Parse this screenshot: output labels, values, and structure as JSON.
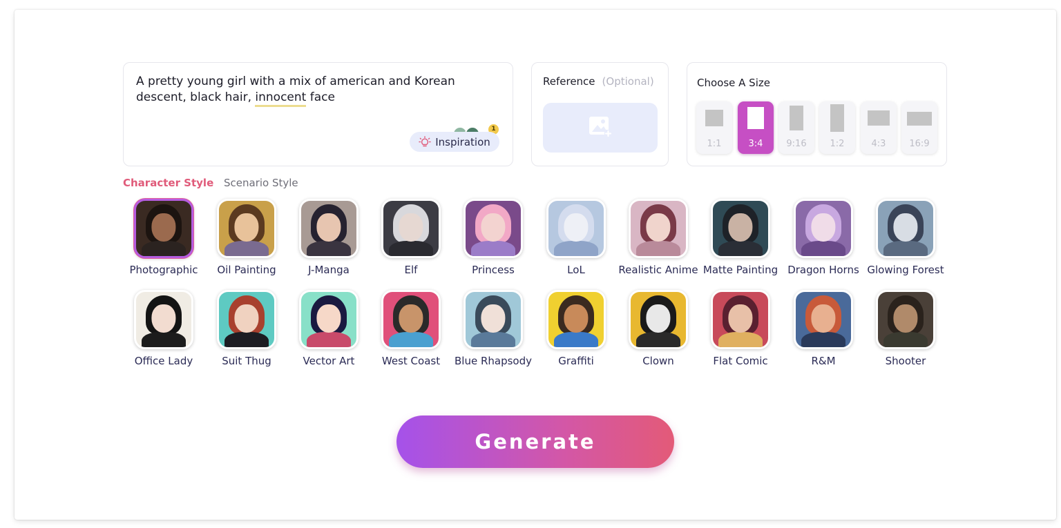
{
  "prompt": {
    "text_before": "A pretty young girl with a mix of american and Korean descent, black hair, ",
    "text_highlight": "innocent",
    "text_after": " face",
    "inspiration_label": "Inspiration",
    "badge_count": "1"
  },
  "reference": {
    "title": "Reference",
    "optional": "(Optional)"
  },
  "size": {
    "title": "Choose A Size",
    "selected": "3:4",
    "options": [
      "1:1",
      "3:4",
      "9:16",
      "1:2",
      "4:3",
      "16:9"
    ]
  },
  "tabs": {
    "character": "Character Style",
    "scenario": "Scenario Style"
  },
  "styles": [
    {
      "label": "Photographic",
      "bg": "#3a2a22",
      "skin": "#9b6a4e",
      "hair": "#1c1410",
      "cloth": "#2b2320"
    },
    {
      "label": "Oil Painting",
      "bg": "#c9a04a",
      "skin": "#e8c29a",
      "hair": "#5b3a20",
      "cloth": "#7a6b90"
    },
    {
      "label": "J-Manga",
      "bg": "#a89a94",
      "skin": "#e7c5b0",
      "hair": "#262230",
      "cloth": "#3a3440"
    },
    {
      "label": "Elf",
      "bg": "#3c3c44",
      "skin": "#e6d8d2",
      "hair": "#d8d8dc",
      "cloth": "#2a2a30"
    },
    {
      "label": "Princess",
      "bg": "#7a4a8a",
      "skin": "#f3d3d0",
      "hair": "#f2a8c6",
      "cloth": "#9b7cc8"
    },
    {
      "label": "LoL",
      "bg": "#b6c8e0",
      "skin": "#eef0f6",
      "hair": "#d4dcee",
      "cloth": "#8fa4c8"
    },
    {
      "label": "Realistic Anime",
      "bg": "#d9b6c4",
      "skin": "#f0d4cc",
      "hair": "#7a3a48",
      "cloth": "#b98a9a"
    },
    {
      "label": "Matte Painting",
      "bg": "#2f4a55",
      "skin": "#c9b2a4",
      "hair": "#1e2228",
      "cloth": "#2a2e36"
    },
    {
      "label": "Dragon Horns",
      "bg": "#8a6aa8",
      "skin": "#f0dce8",
      "hair": "#c8a8e0",
      "cloth": "#6a4a8a"
    },
    {
      "label": "Glowing Forest",
      "bg": "#8aa2b8",
      "skin": "#d8dde4",
      "hair": "#3a4458",
      "cloth": "#5a6a80"
    },
    {
      "label": "Office Lady",
      "bg": "#f0ece4",
      "skin": "#f2dcd0",
      "hair": "#141414",
      "cloth": "#1c1c1c"
    },
    {
      "label": "Suit Thug",
      "bg": "#5ecac2",
      "skin": "#f0d2c0",
      "hair": "#a8402e",
      "cloth": "#1c1c22"
    },
    {
      "label": "Vector Art",
      "bg": "#88e0c8",
      "skin": "#f6d8c8",
      "hair": "#1a1a40",
      "cloth": "#c84a6a"
    },
    {
      "label": "West Coast",
      "bg": "#e0507a",
      "skin": "#c8946a",
      "hair": "#2a2a2a",
      "cloth": "#4aa0d0"
    },
    {
      "label": "Blue Rhapsody",
      "bg": "#a0c8d8",
      "skin": "#f0e0d8",
      "hair": "#3a4a5a",
      "cloth": "#5a7a9a"
    },
    {
      "label": "Graffiti",
      "bg": "#f0d030",
      "skin": "#c88a5a",
      "hair": "#3a2a20",
      "cloth": "#3a7ac8"
    },
    {
      "label": "Clown",
      "bg": "#e8b830",
      "skin": "#e8e8e8",
      "hair": "#1a1a1a",
      "cloth": "#2a2a2a"
    },
    {
      "label": "Flat Comic",
      "bg": "#c84a5a",
      "skin": "#e8c0a8",
      "hair": "#5a2030",
      "cloth": "#e0b060"
    },
    {
      "label": "R&M",
      "bg": "#4a6a9a",
      "skin": "#e8b090",
      "hair": "#c85a3a",
      "cloth": "#2a3a5a"
    },
    {
      "label": "Shooter",
      "bg": "#4a4038",
      "skin": "#b08a6a",
      "hair": "#2a221c",
      "cloth": "#3a3a30"
    }
  ],
  "selected_style": "Photographic",
  "generate_label": "Generate",
  "colors": {
    "accent_pink": "#e05b7a",
    "selected_size": "#c64fc4",
    "generate_start": "#a552ea",
    "generate_end": "#e35a78"
  }
}
